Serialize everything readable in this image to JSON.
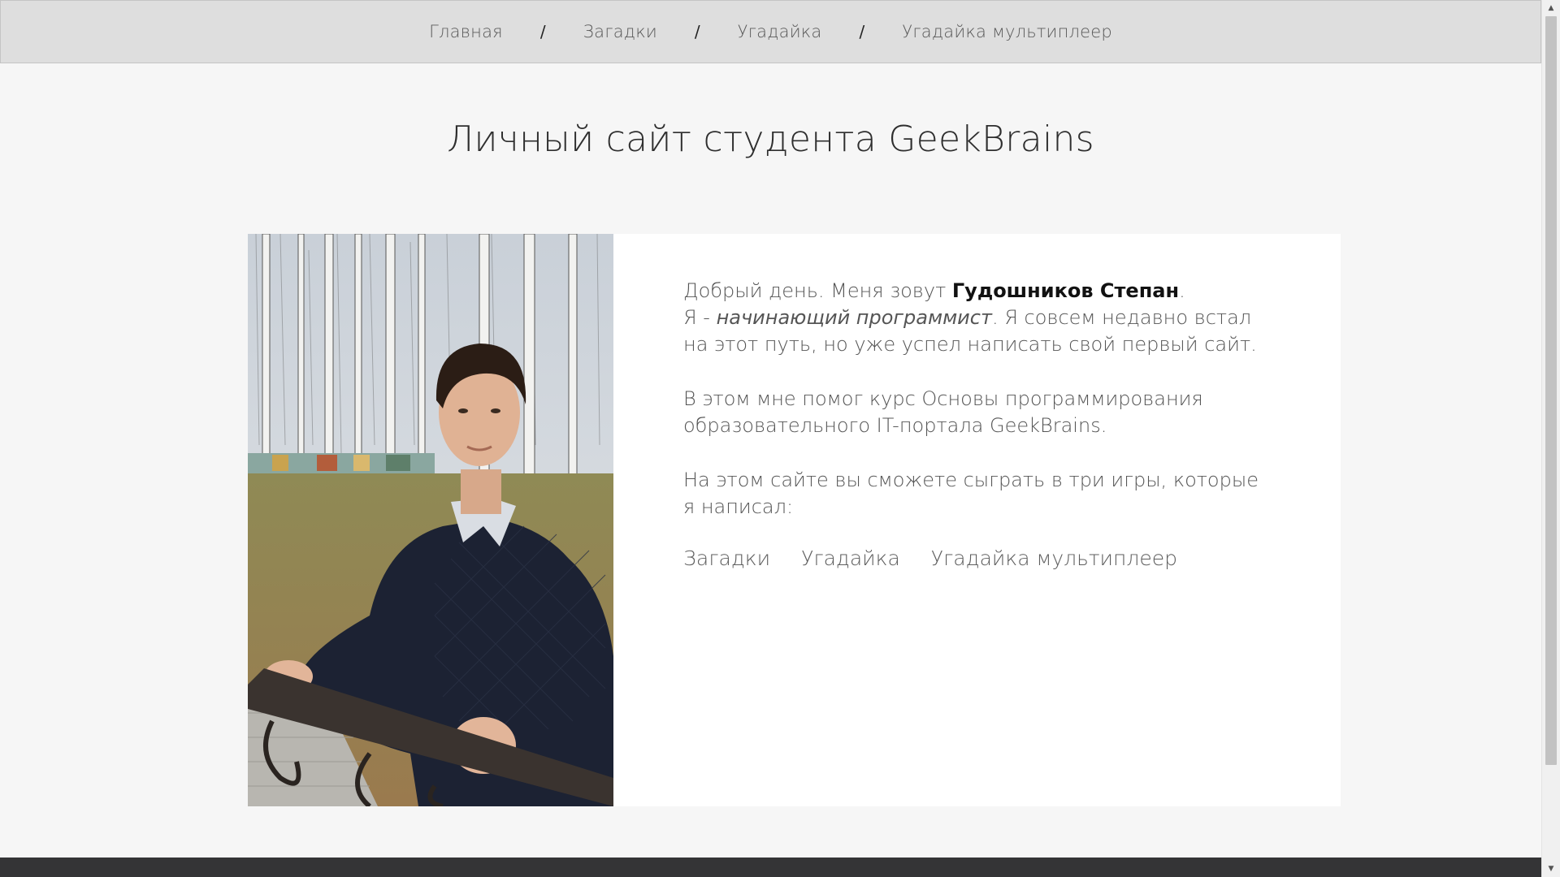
{
  "nav": {
    "items": [
      {
        "label": "Главная"
      },
      {
        "label": "Загадки"
      },
      {
        "label": "Угадайка"
      },
      {
        "label": "Угадайка мультиплеер"
      }
    ],
    "separator": "/"
  },
  "title": "Личный сайт студента GeekBrains",
  "intro": {
    "greeting": "Добрый день. Меня зовут ",
    "name": "Гудошников Степан",
    "period": ".",
    "line2_start": "Я - ",
    "line2_em": "начинающий программист",
    "line2_rest": ". Я совсем недавно встал на этот путь, но уже успел написать свой первый сайт.",
    "para2": "В этом мне помог курс Основы программирования образовательного IT-портала GeekBrains.",
    "para3": "На этом сайте вы сможете сыграть в три игры, которые я написал:"
  },
  "games": [
    {
      "label": "Загадки"
    },
    {
      "label": "Угадайка"
    },
    {
      "label": "Угадайка мультиплеер"
    }
  ],
  "photo": {
    "icon": "person-photo"
  },
  "colors": {
    "nav_bg": "#dedede",
    "page_bg": "#f6f6f6",
    "footer_bg": "#343436"
  }
}
